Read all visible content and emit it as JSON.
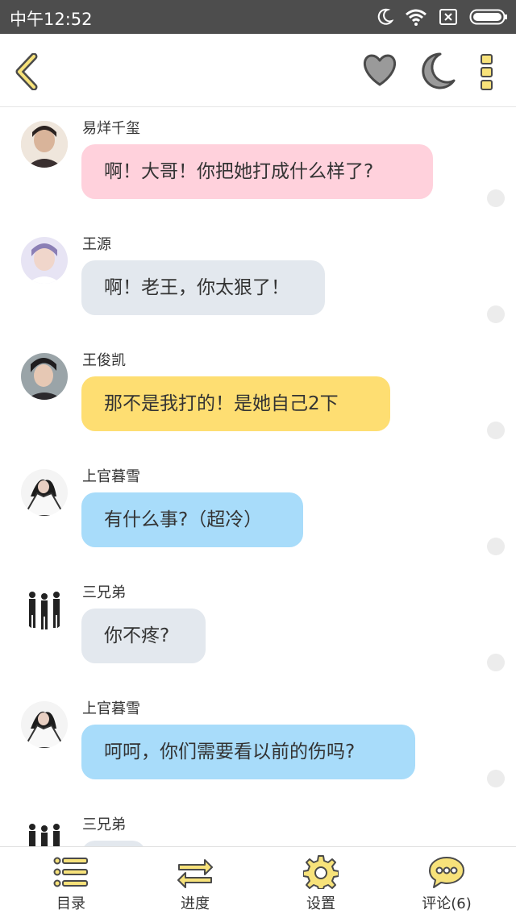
{
  "status_bar": {
    "time": "中午12:52"
  },
  "header": {
    "back_icon": "chevron-left-icon",
    "actions": [
      "heart-icon",
      "moon-icon",
      "more-vertical-icon"
    ]
  },
  "messages": [
    {
      "sender": "易烊千玺",
      "text": "啊！大哥！你把她打成什么样了?",
      "bubble_color": "#ffd1dc"
    },
    {
      "sender": "王源",
      "text": "啊！老王，你太狠了！",
      "bubble_color": "#e3e8ee"
    },
    {
      "sender": "王俊凯",
      "text": "那不是我打的！是她自己2下",
      "bubble_color": "#fede72"
    },
    {
      "sender": "上官暮雪",
      "text": "有什么事?（超冷）",
      "bubble_color": "#a8dcfa"
    },
    {
      "sender": "三兄弟",
      "text": "你不疼?",
      "bubble_color": "#e3e8ee"
    },
    {
      "sender": "上官暮雪",
      "text": "呵呵，你们需要看以前的伤吗?",
      "bubble_color": "#a8dcfa"
    },
    {
      "sender": "三兄弟",
      "text": "",
      "bubble_color": "#e3e8ee"
    }
  ],
  "tab_bar": {
    "catalog": "目录",
    "progress": "进度",
    "settings": "设置",
    "comments": "评论(6)"
  },
  "colors": {
    "accent_yellow": "#f7e27a",
    "icon_outline": "#4a4a4a",
    "nav_icon_gray": "#9a9a9a"
  }
}
